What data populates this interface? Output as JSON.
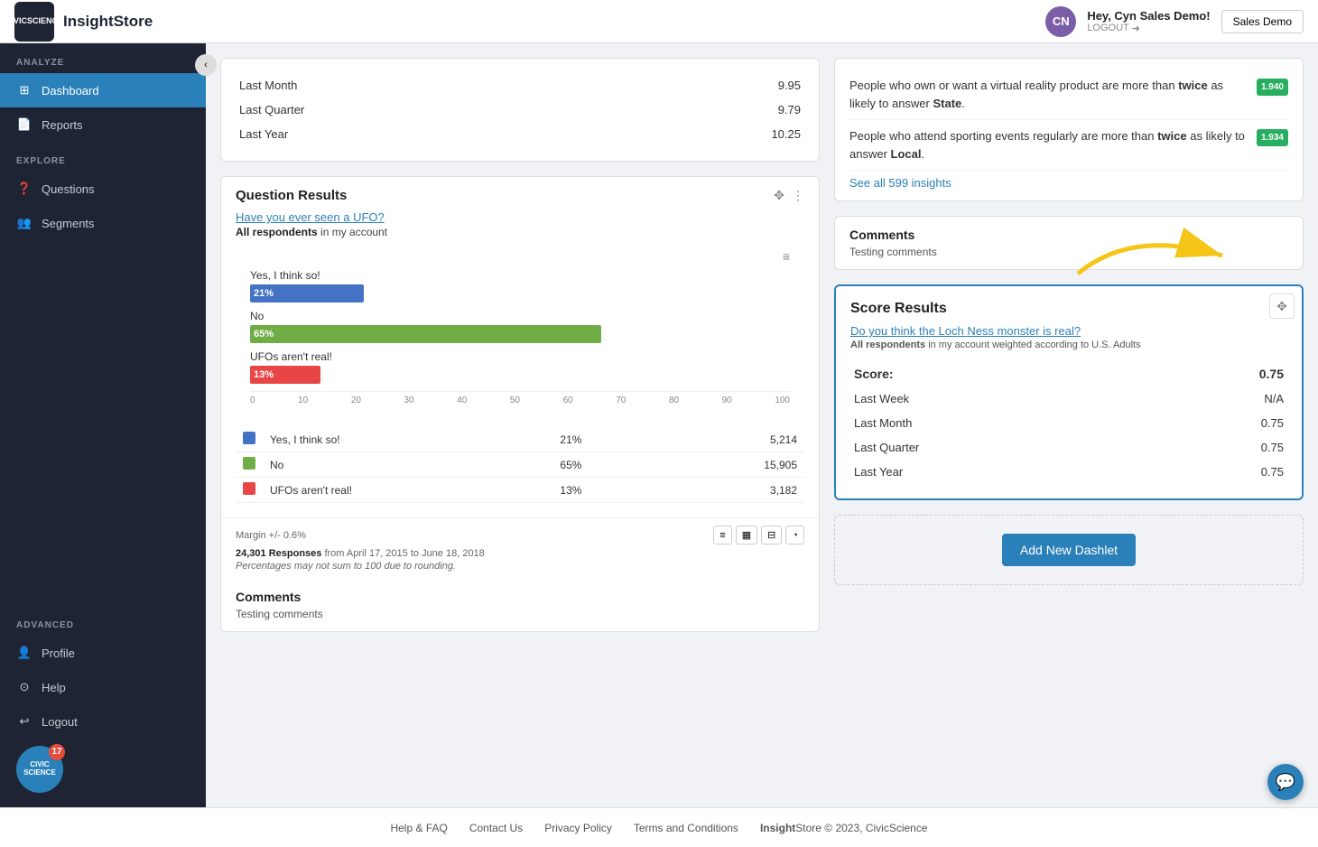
{
  "topbar": {
    "logo_line1": "CIVIC",
    "logo_line2": "SCIENCE",
    "app_name": "InsightStore",
    "user_initials": "CN",
    "user_name": "Hey, Cyn Sales Demo!",
    "logout_label": "LOGOUT",
    "sales_demo_label": "Sales Demo"
  },
  "sidebar": {
    "analyze_label": "ANALYZE",
    "explore_label": "EXPLORE",
    "advanced_label": "ADVANCED",
    "items": [
      {
        "id": "dashboard",
        "label": "Dashboard",
        "active": true
      },
      {
        "id": "reports",
        "label": "Reports",
        "active": false
      },
      {
        "id": "questions",
        "label": "Questions",
        "active": false
      },
      {
        "id": "segments",
        "label": "Segments",
        "active": false
      },
      {
        "id": "profile",
        "label": "Profile",
        "active": false
      },
      {
        "id": "help",
        "label": "Help",
        "active": false
      },
      {
        "id": "logout",
        "label": "Logout",
        "active": false
      }
    ],
    "badge_count": "17"
  },
  "score_table": {
    "rows": [
      {
        "label": "Last Month",
        "value": "9.95"
      },
      {
        "label": "Last Quarter",
        "value": "9.79"
      },
      {
        "label": "Last Year",
        "value": "10.25"
      }
    ]
  },
  "question_results": {
    "title": "Question Results",
    "question_link": "Have you ever seen a UFO?",
    "respondents_prefix": "All respondents",
    "respondents_suffix": "in my account",
    "bars": [
      {
        "label": "Yes, I think so!",
        "pct": 21,
        "color": "#4472c4",
        "pct_label": "21%"
      },
      {
        "label": "No",
        "pct": 65,
        "color": "#70ad47",
        "pct_label": "65%"
      },
      {
        "label": "UFOs aren't real!",
        "pct": 13,
        "color": "#e84646",
        "pct_label": "13%"
      }
    ],
    "axis_labels": [
      "0",
      "10",
      "20",
      "30",
      "40",
      "50",
      "60",
      "70",
      "80",
      "90",
      "100"
    ],
    "legend": [
      {
        "label": "Yes, I think so!",
        "color": "#4472c4",
        "pct": "21%",
        "count": "5,214"
      },
      {
        "label": "No",
        "color": "#70ad47",
        "pct": "65%",
        "count": "15,905"
      },
      {
        "label": "UFOs aren't real!",
        "color": "#e84646",
        "pct": "13%",
        "count": "3,182"
      }
    ],
    "margin": "Margin +/- 0.6%",
    "responses": "24,301 Responses",
    "date_range": "from April 17, 2015 to June 18, 2018",
    "rounding_note": "Percentages may not sum to 100 due to rounding."
  },
  "comments": {
    "title": "Comments",
    "text": "Testing comments"
  },
  "insights": {
    "rows": [
      {
        "text_before": "People who own or want a virtual reality product are more than ",
        "bold1": "twice",
        "text_middle": " as likely to answer ",
        "bold2": "State",
        "text_after": ".",
        "badge": "1.940"
      },
      {
        "text_before": "People who attend sporting events regularly are more than ",
        "bold1": "twice",
        "text_middle": " as likely to answer ",
        "bold2": "Local",
        "text_after": ".",
        "badge": "1.934"
      }
    ],
    "see_all_label": "See all 599 insights"
  },
  "right_comments": {
    "title": "Comments",
    "text": "Testing comments"
  },
  "score_results": {
    "title": "Score Results",
    "question_link": "Do you think the Loch Ness monster is real?",
    "respondents_prefix": "All respondents",
    "respondents_suffix": "in my account weighted according to U.S. Adults",
    "rows": [
      {
        "label": "Score:",
        "value": "0.75"
      },
      {
        "label": "Last Week",
        "value": "N/A"
      },
      {
        "label": "Last Month",
        "value": "0.75"
      },
      {
        "label": "Last Quarter",
        "value": "0.75"
      },
      {
        "label": "Last Year",
        "value": "0.75"
      }
    ]
  },
  "add_dashlet": {
    "button_label": "Add New Dashlet"
  },
  "footer": {
    "help_label": "Help & FAQ",
    "contact_label": "Contact Us",
    "privacy_label": "Privacy Policy",
    "terms_label": "Terms and Conditions",
    "copyright": "InsightStore © 2023, CivicScience"
  }
}
